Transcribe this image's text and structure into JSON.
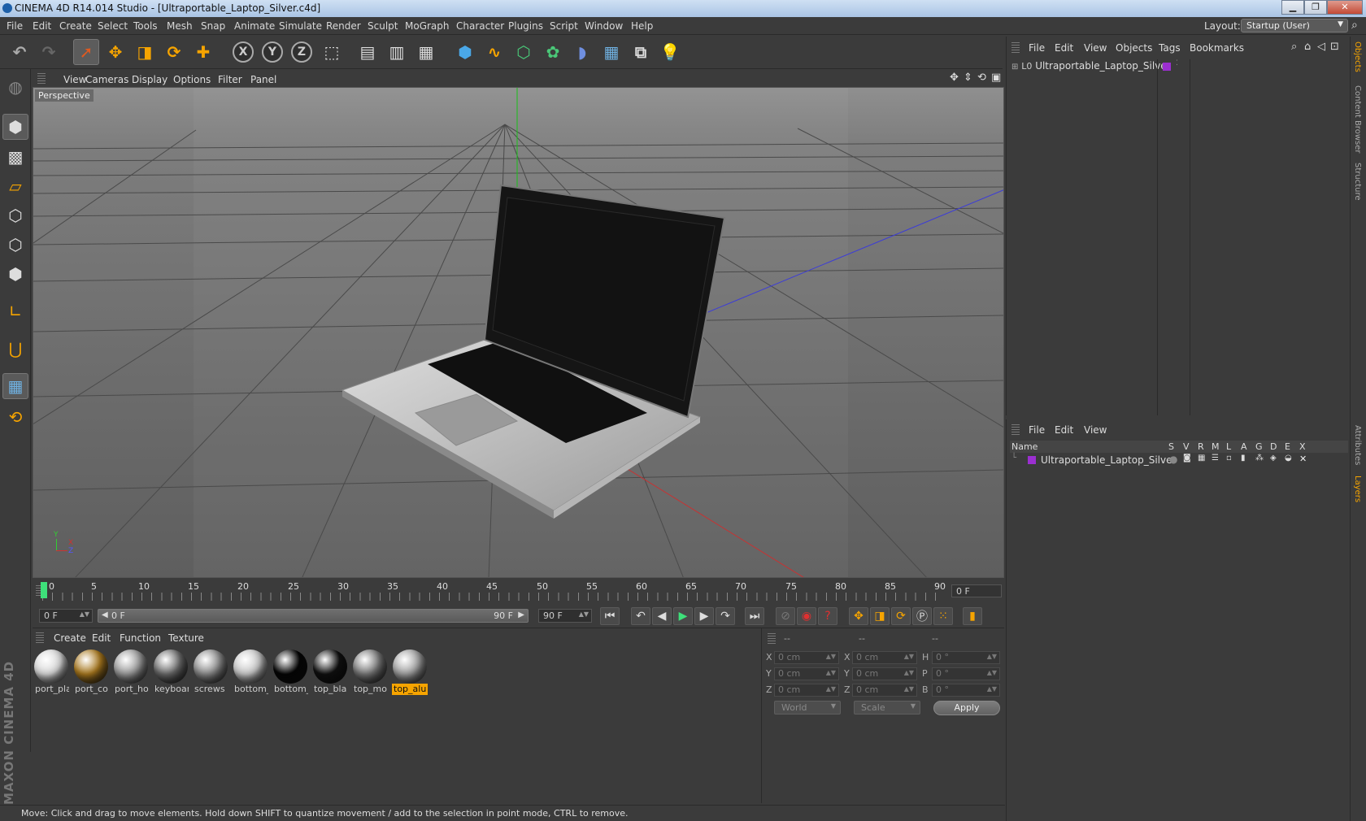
{
  "window": {
    "title": "CINEMA 4D R14.014 Studio - [Ultraportable_Laptop_Silver.c4d]",
    "controls": [
      "▁",
      "❐",
      "✕"
    ]
  },
  "menubar": {
    "items": [
      "File",
      "Edit",
      "Create",
      "Select",
      "Tools",
      "Mesh",
      "Snap",
      "Animate",
      "Simulate",
      "Render",
      "Sculpt",
      "MoGraph",
      "Character",
      "Plugins",
      "Script",
      "Window",
      "Help"
    ],
    "layout_label": "Layout:",
    "layout_value": "Startup (User)"
  },
  "toolbar": {
    "axis_x": "X",
    "axis_y": "Y",
    "axis_z": "Z"
  },
  "viewport": {
    "menu": [
      "View",
      "Cameras",
      "Display",
      "Options",
      "Filter",
      "Panel"
    ],
    "camera_label": "Perspective",
    "axis_labels": {
      "x": "X",
      "y": "Y",
      "z": "Z"
    }
  },
  "timeline": {
    "frames": [
      "0",
      "5",
      "10",
      "15",
      "20",
      "25",
      "30",
      "35",
      "40",
      "45",
      "50",
      "55",
      "60",
      "65",
      "70",
      "75",
      "80",
      "85",
      "90"
    ],
    "current_frame": "0 F"
  },
  "transport": {
    "start_field": "0 F",
    "slider_start": "0 F",
    "slider_end": "90 F",
    "end_field": "90 F"
  },
  "materials": {
    "menu": [
      "Create",
      "Edit",
      "Function",
      "Texture"
    ],
    "items": [
      {
        "name": "port_pla",
        "color": "#d8d8d8"
      },
      {
        "name": "port_co",
        "color": "#a8781e"
      },
      {
        "name": "port_ho",
        "color": "#9a9a9a"
      },
      {
        "name": "keyboar",
        "color": "#6a6a6a"
      },
      {
        "name": "screws",
        "color": "#8a8a8a"
      },
      {
        "name": "bottom_",
        "color": "#c8c8c8"
      },
      {
        "name": "bottom_",
        "color": "#050505"
      },
      {
        "name": "top_bla",
        "color": "#101010"
      },
      {
        "name": "top_mo",
        "color": "#777777"
      },
      {
        "name": "top_alu",
        "color": "#a0a0a0"
      }
    ]
  },
  "coordinates": {
    "headers": [
      "--",
      "--",
      "--"
    ],
    "rows": [
      {
        "l1": "X",
        "v1": "0 cm",
        "l2": "X",
        "v2": "0 cm",
        "l3": "H",
        "v3": "0 °"
      },
      {
        "l1": "Y",
        "v1": "0 cm",
        "l2": "Y",
        "v2": "0 cm",
        "l3": "P",
        "v3": "0 °"
      },
      {
        "l1": "Z",
        "v1": "0 cm",
        "l2": "Z",
        "v2": "0 cm",
        "l3": "B",
        "v3": "0 °"
      }
    ],
    "mode1": "World",
    "mode2": "Scale",
    "apply": "Apply"
  },
  "status": "Move: Click and drag to move elements. Hold down SHIFT to quantize movement / add to the selection in point mode, CTRL to remove.",
  "objects": {
    "menu": [
      "File",
      "Edit",
      "View",
      "Objects",
      "Tags",
      "Bookmarks"
    ],
    "item": "Ultraportable_Laptop_Silver",
    "layer_color": "#9b2fd0"
  },
  "layers": {
    "menu": [
      "File",
      "Edit",
      "View"
    ],
    "columns": [
      "Name",
      "S",
      "V",
      "R",
      "M",
      "L",
      "A",
      "G",
      "D",
      "E",
      "X"
    ],
    "item": "Ultraportable_Laptop_Silver"
  },
  "sidetabs": {
    "top": [
      "Objects",
      "Content Browser",
      "Structure"
    ],
    "bottom": [
      "Attributes",
      "Layers"
    ]
  },
  "brand": "MAXON CINEMA 4D",
  "colors": {
    "accent": "#f6a400",
    "panel": "#3b3b3b",
    "active_green": "#3ee07a"
  }
}
